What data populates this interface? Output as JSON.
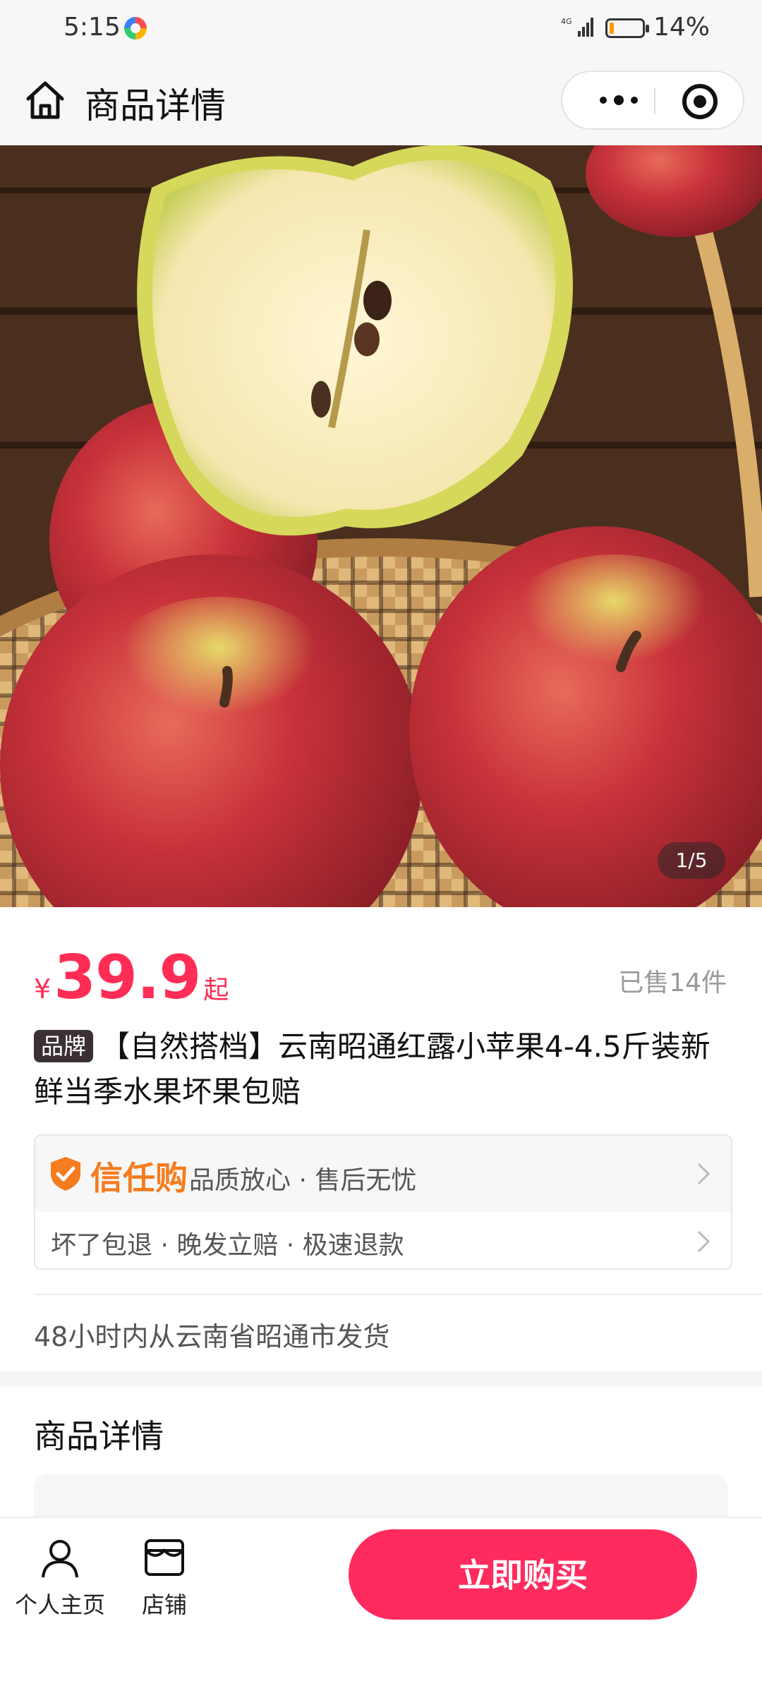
{
  "status_bar": {
    "time": "5:15",
    "network": "4G",
    "battery": "14%",
    "battery_level": 0.14
  },
  "nav": {
    "title": "商品详情",
    "home_icon": "home-icon",
    "more_icon": "more-dots-icon",
    "close_icon": "target-close-icon"
  },
  "gallery": {
    "counter": "1/5",
    "image_subject": "red-apples-in-bamboo-basket"
  },
  "product": {
    "currency": "¥",
    "price": "39.9",
    "price_suffix": "起",
    "sold": "已售14件",
    "brand_badge": "品牌",
    "title": "【自然搭档】云南昭通红露小苹果4-4.5斤装新鲜当季水果坏果包赔"
  },
  "trust": {
    "brand": "信任购",
    "line1": "品质放心 · 售后无忧",
    "line2": "坏了包退 · 晚发立赔 · 极速退款"
  },
  "shipping": {
    "text": "48小时内从云南省昭通市发货"
  },
  "detail": {
    "title": "商品详情"
  },
  "bottom_bar": {
    "profile_label": "个人主页",
    "shop_label": "店铺",
    "buy_label": "立即购买"
  },
  "colors": {
    "accent": "#ff2d55",
    "buy_button": "#ff2b5e",
    "trust_orange": "#f57c1f"
  }
}
